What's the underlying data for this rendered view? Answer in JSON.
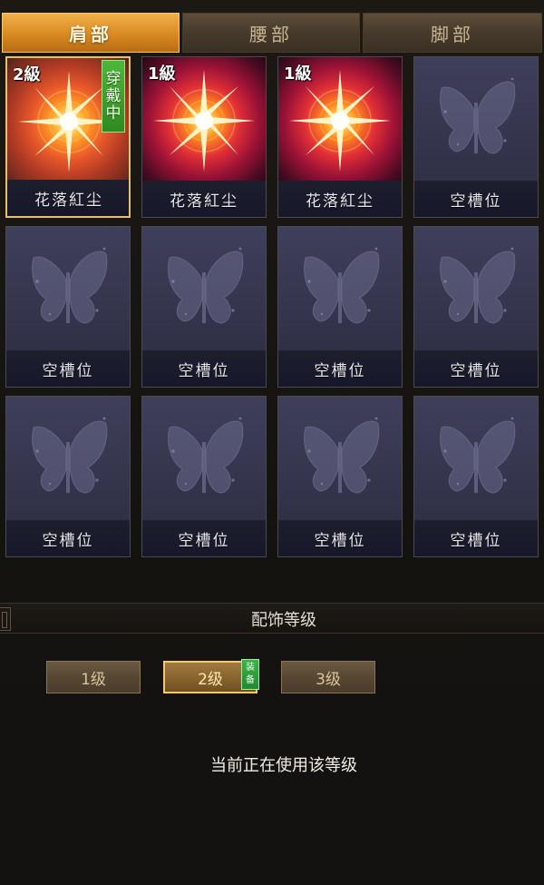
{
  "tabs": [
    {
      "label": "肩部",
      "active": true
    },
    {
      "label": "腰部",
      "active": false
    },
    {
      "label": "脚部",
      "active": false
    }
  ],
  "slots": [
    {
      "name": "花落紅尘",
      "level": "2級",
      "filled": true,
      "selected": true,
      "badge": [
        "穿",
        "戴",
        "中"
      ],
      "icon": "starburst-icon"
    },
    {
      "name": "花落紅尘",
      "level": "1級",
      "filled": true,
      "selected": false,
      "icon": "starburst-icon"
    },
    {
      "name": "花落紅尘",
      "level": "1級",
      "filled": true,
      "selected": false,
      "icon": "starburst-icon"
    },
    {
      "name": "空槽位",
      "filled": false,
      "icon": "butterfly-icon"
    },
    {
      "name": "空槽位",
      "filled": false,
      "icon": "butterfly-icon"
    },
    {
      "name": "空槽位",
      "filled": false,
      "icon": "butterfly-icon"
    },
    {
      "name": "空槽位",
      "filled": false,
      "icon": "butterfly-icon"
    },
    {
      "name": "空槽位",
      "filled": false,
      "icon": "butterfly-icon"
    },
    {
      "name": "空槽位",
      "filled": false,
      "icon": "butterfly-icon"
    },
    {
      "name": "空槽位",
      "filled": false,
      "icon": "butterfly-icon"
    },
    {
      "name": "空槽位",
      "filled": false,
      "icon": "butterfly-icon"
    },
    {
      "name": "空槽位",
      "filled": false,
      "icon": "butterfly-icon"
    }
  ],
  "level_section": {
    "title": "配饰等级",
    "buttons": [
      {
        "label": "1级",
        "active": false
      },
      {
        "label": "2级",
        "active": true
      },
      {
        "label": "3级",
        "active": false
      }
    ],
    "equip_badge": [
      "装",
      "备"
    ],
    "status": "当前正在使用该等级"
  },
  "colors": {
    "accent_gold": "#f2c871",
    "badge_green": "#2e8a20",
    "slot_bg": "#33334b",
    "page_bg": "#151310"
  }
}
